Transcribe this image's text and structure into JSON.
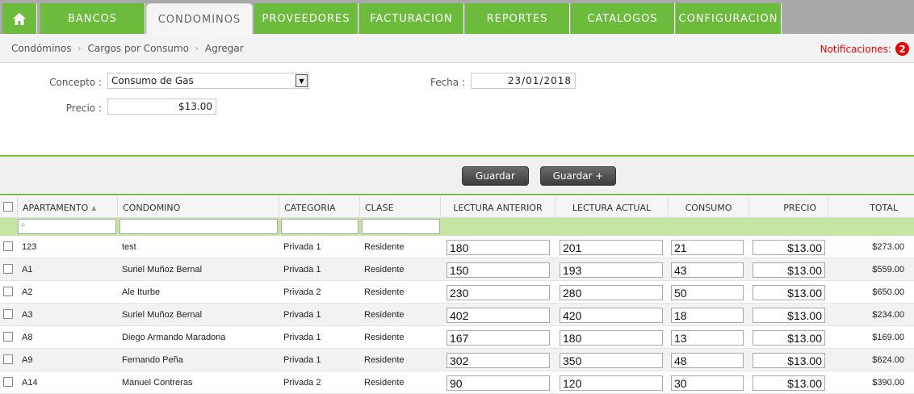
{
  "nav": {
    "items": [
      "BANCOS",
      "CONDOMINOS",
      "PROVEEDORES",
      "FACTURACION",
      "REPORTES",
      "CATALOGOS",
      "CONFIGURACION"
    ],
    "active": "CONDOMINOS"
  },
  "breadcrumb": [
    "Condóminos",
    "Cargos por Consumo",
    "Agregar"
  ],
  "notifications": {
    "label": "Notificaciones:",
    "count": "2"
  },
  "form": {
    "concepto_label": "Concepto :",
    "concepto_value": "Consumo de Gas",
    "precio_label": "Precio :",
    "precio_value": "$13.00",
    "fecha_label": "Fecha :",
    "fecha_value": "23/01/2018"
  },
  "toolbar": {
    "save_label": "Guardar",
    "save_plus_label": "Guardar +"
  },
  "table": {
    "columns": [
      "APARTAMENTO",
      "CONDOMINO",
      "CATEGORIA",
      "CLASE",
      "LECTURA ANTERIOR",
      "LECTURA ACTUAL",
      "CONSUMO",
      "PRECIO",
      "TOTAL"
    ],
    "rows": [
      {
        "apartamento": "123",
        "condomino": "test",
        "categoria": "Privada 1",
        "clase": "Residente",
        "anterior": "180",
        "actual": "201",
        "consumo": "21",
        "precio": "$13.00",
        "total": "$273.00"
      },
      {
        "apartamento": "A1",
        "condomino": "Suriel Muñoz Bernal",
        "categoria": "Privada 1",
        "clase": "Residente",
        "anterior": "150",
        "actual": "193",
        "consumo": "43",
        "precio": "$13.00",
        "total": "$559.00"
      },
      {
        "apartamento": "A2",
        "condomino": "Ale Iturbe",
        "categoria": "Privada 2",
        "clase": "Residente",
        "anterior": "230",
        "actual": "280",
        "consumo": "50",
        "precio": "$13.00",
        "total": "$650.00"
      },
      {
        "apartamento": "A3",
        "condomino": "Suriel Muñoz Bernal",
        "categoria": "Privada 1",
        "clase": "Residente",
        "anterior": "402",
        "actual": "420",
        "consumo": "18",
        "precio": "$13.00",
        "total": "$234.00"
      },
      {
        "apartamento": "A8",
        "condomino": "Diego Armando Maradona",
        "categoria": "Privada 1",
        "clase": "Residente",
        "anterior": "167",
        "actual": "180",
        "consumo": "13",
        "precio": "$13.00",
        "total": "$169.00"
      },
      {
        "apartamento": "A9",
        "condomino": "Fernando Peña",
        "categoria": "Privada 1",
        "clase": "Residente",
        "anterior": "302",
        "actual": "350",
        "consumo": "48",
        "precio": "$13.00",
        "total": "$624.00"
      },
      {
        "apartamento": "A14",
        "condomino": "Manuel Contreras",
        "categoria": "Privada 2",
        "clase": "Residente",
        "anterior": "90",
        "actual": "120",
        "consumo": "30",
        "precio": "$13.00",
        "total": "$390.00"
      }
    ]
  }
}
